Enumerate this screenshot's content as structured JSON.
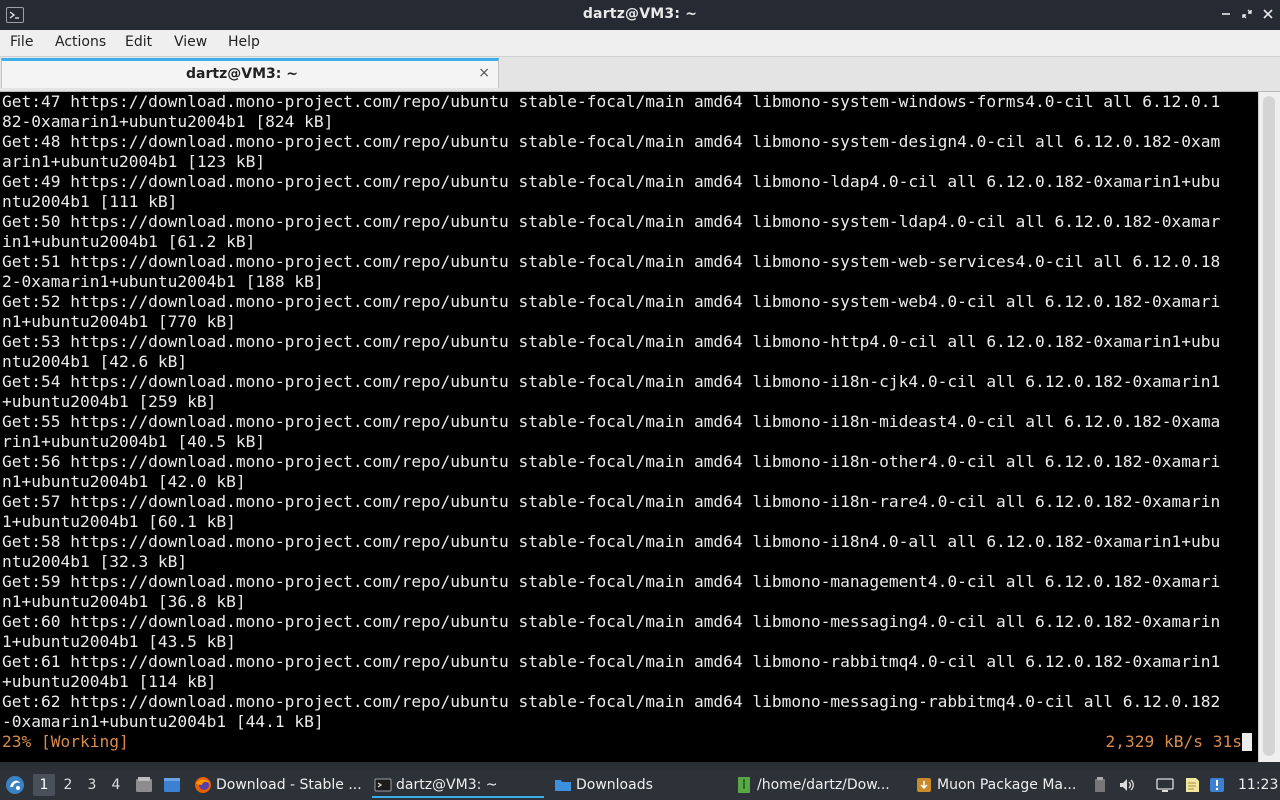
{
  "window": {
    "title": "dartz@VM3: ~",
    "icon": "terminal-icon",
    "controls": [
      "minimize-icon",
      "maximize-icon",
      "close-icon"
    ]
  },
  "menubar": {
    "items": [
      "File",
      "Actions",
      "Edit",
      "View",
      "Help"
    ]
  },
  "tabs": [
    {
      "label": "dartz@VM3: ~",
      "close_glyph": "×"
    }
  ],
  "terminal": {
    "lines": [
      "Get:47 https://download.mono-project.com/repo/ubuntu stable-focal/main amd64 libmono-system-windows-forms4.0-cil all 6.12.0.1",
      "82-0xamarin1+ubuntu2004b1 [824 kB]",
      "Get:48 https://download.mono-project.com/repo/ubuntu stable-focal/main amd64 libmono-system-design4.0-cil all 6.12.0.182-0xam",
      "arin1+ubuntu2004b1 [123 kB]",
      "Get:49 https://download.mono-project.com/repo/ubuntu stable-focal/main amd64 libmono-ldap4.0-cil all 6.12.0.182-0xamarin1+ubu",
      "ntu2004b1 [111 kB]",
      "Get:50 https://download.mono-project.com/repo/ubuntu stable-focal/main amd64 libmono-system-ldap4.0-cil all 6.12.0.182-0xamar",
      "in1+ubuntu2004b1 [61.2 kB]",
      "Get:51 https://download.mono-project.com/repo/ubuntu stable-focal/main amd64 libmono-system-web-services4.0-cil all 6.12.0.18",
      "2-0xamarin1+ubuntu2004b1 [188 kB]",
      "Get:52 https://download.mono-project.com/repo/ubuntu stable-focal/main amd64 libmono-system-web4.0-cil all 6.12.0.182-0xamari",
      "n1+ubuntu2004b1 [770 kB]",
      "Get:53 https://download.mono-project.com/repo/ubuntu stable-focal/main amd64 libmono-http4.0-cil all 6.12.0.182-0xamarin1+ubu",
      "ntu2004b1 [42.6 kB]",
      "Get:54 https://download.mono-project.com/repo/ubuntu stable-focal/main amd64 libmono-i18n-cjk4.0-cil all 6.12.0.182-0xamarin1",
      "+ubuntu2004b1 [259 kB]",
      "Get:55 https://download.mono-project.com/repo/ubuntu stable-focal/main amd64 libmono-i18n-mideast4.0-cil all 6.12.0.182-0xama",
      "rin1+ubuntu2004b1 [40.5 kB]",
      "Get:56 https://download.mono-project.com/repo/ubuntu stable-focal/main amd64 libmono-i18n-other4.0-cil all 6.12.0.182-0xamari",
      "n1+ubuntu2004b1 [42.0 kB]",
      "Get:57 https://download.mono-project.com/repo/ubuntu stable-focal/main amd64 libmono-i18n-rare4.0-cil all 6.12.0.182-0xamarin",
      "1+ubuntu2004b1 [60.1 kB]",
      "Get:58 https://download.mono-project.com/repo/ubuntu stable-focal/main amd64 libmono-i18n4.0-all all 6.12.0.182-0xamarin1+ubu",
      "ntu2004b1 [32.3 kB]",
      "Get:59 https://download.mono-project.com/repo/ubuntu stable-focal/main amd64 libmono-management4.0-cil all 6.12.0.182-0xamari",
      "n1+ubuntu2004b1 [36.8 kB]",
      "Get:60 https://download.mono-project.com/repo/ubuntu stable-focal/main amd64 libmono-messaging4.0-cil all 6.12.0.182-0xamarin",
      "1+ubuntu2004b1 [43.5 kB]",
      "Get:61 https://download.mono-project.com/repo/ubuntu stable-focal/main amd64 libmono-rabbitmq4.0-cil all 6.12.0.182-0xamarin1",
      "+ubuntu2004b1 [114 kB]",
      "Get:62 https://download.mono-project.com/repo/ubuntu stable-focal/main amd64 libmono-messaging-rabbitmq4.0-cil all 6.12.0.182",
      "-0xamarin1+ubuntu2004b1 [44.1 kB]"
    ],
    "status_left": "23% [Working]",
    "status_right": "2,329 kB/s 31s",
    "colors": {
      "background": "#000000",
      "text": "#ebebeb",
      "status": "#d98b4c"
    }
  },
  "taskbar": {
    "start_icon": "start-menu-icon",
    "workspaces": [
      "1",
      "2",
      "3",
      "4"
    ],
    "active_workspace": "1",
    "quick_launch": [
      "file-manager-icon",
      "show-desktop-icon"
    ],
    "tasks": [
      {
        "label": "Download - Stable ...",
        "icon": "firefox-icon",
        "active": false
      },
      {
        "label": "dartz@VM3: ~",
        "icon": "terminal-icon",
        "active": true
      },
      {
        "label": "Downloads",
        "icon": "folder-icon",
        "active": false
      },
      {
        "label": "/home/dartz/Dow...",
        "icon": "archive-icon",
        "active": false
      },
      {
        "label": "Muon Package Ma...",
        "icon": "package-manager-icon",
        "active": false
      }
    ],
    "tray": [
      "clipboard-icon",
      "volume-icon",
      "network-icon",
      "notes-icon",
      "updates-icon"
    ],
    "clock": "11:23",
    "accent": "#3daee9"
  }
}
